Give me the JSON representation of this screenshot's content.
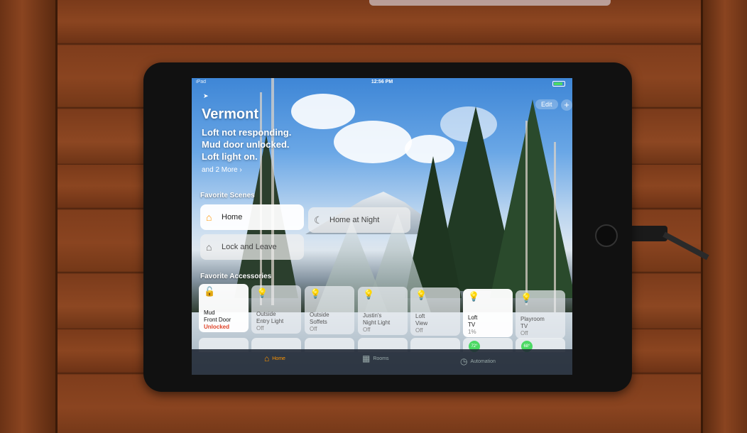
{
  "status_bar": {
    "carrier": "iPad",
    "time": "12:56 PM"
  },
  "header": {
    "edit_label": "Edit",
    "add_label": "+",
    "home_name": "Vermont",
    "status_lines": [
      "Loft not responding.",
      "Mud door unlocked.",
      "Loft light on."
    ],
    "more_link": "and 2 More ›"
  },
  "favorite_scenes": {
    "title": "Favorite Scenes",
    "items": [
      {
        "label": "Home",
        "icon": "home-scene-icon",
        "active": true
      },
      {
        "label": "Home at Night",
        "icon": "night-scene-icon",
        "active": false
      },
      {
        "label": "Lock and Leave",
        "icon": "leave-scene-icon",
        "active": false
      }
    ]
  },
  "favorite_accessories": {
    "title": "Favorite Accessories",
    "items": [
      {
        "name_line1": "Mud",
        "name_line2": "Front Door",
        "state": "Unlocked",
        "icon": "lock-icon",
        "active": true,
        "alert": true
      },
      {
        "name_line1": "Outside",
        "name_line2": "Entry Light",
        "state": "Off",
        "icon": "bulb-icon",
        "active": false,
        "alert": false
      },
      {
        "name_line1": "Outside",
        "name_line2": "Soffets",
        "state": "Off",
        "icon": "bulb-icon",
        "active": false,
        "alert": false
      },
      {
        "name_line1": "Justin's",
        "name_line2": "Night Light",
        "state": "Off",
        "icon": "bulb-icon",
        "active": false,
        "alert": false
      },
      {
        "name_line1": "Loft",
        "name_line2": "View",
        "state": "Off",
        "icon": "bulb-icon",
        "active": false,
        "alert": false
      },
      {
        "name_line1": "Loft",
        "name_line2": "TV",
        "state": "1%",
        "icon": "bulb-icon",
        "active": true,
        "alert": false
      },
      {
        "name_line1": "Playroom",
        "name_line2": "TV",
        "state": "Off",
        "icon": "bulb-icon",
        "active": false,
        "alert": false
      }
    ],
    "peek_badges": [
      "72°",
      "68°"
    ]
  },
  "tab_bar": {
    "tabs": [
      {
        "label": "Home",
        "icon": "house-icon",
        "active": true
      },
      {
        "label": "Rooms",
        "icon": "rooms-icon",
        "active": false
      },
      {
        "label": "Automation",
        "icon": "automation-icon",
        "active": false
      }
    ]
  },
  "colors": {
    "accent": "#ff9500",
    "alert": "#e0452a",
    "battery": "#4cd964"
  }
}
